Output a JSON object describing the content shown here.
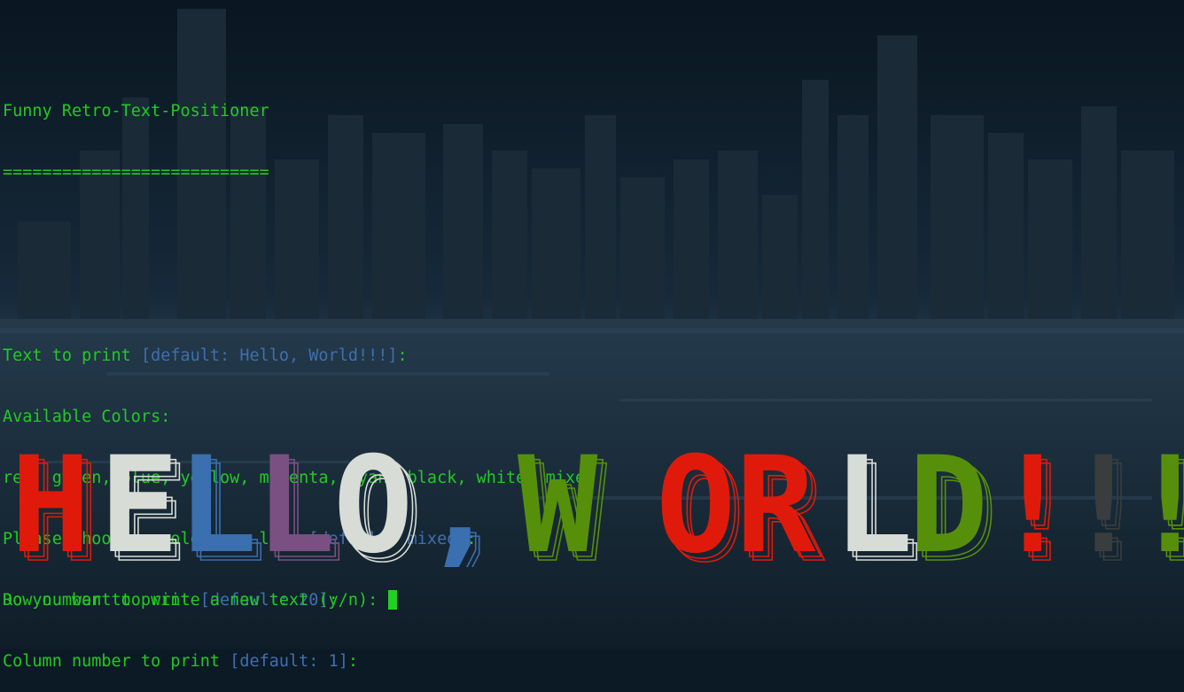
{
  "terminal": {
    "title": "Funny Retro-Text-Positioner",
    "underline": "===========================",
    "lines": [
      {
        "label": "Text to print ",
        "hint": "[default: Hello, World!!!]",
        "end": ":"
      },
      {
        "label": "Available Colors:",
        "hint": "",
        "end": ""
      },
      {
        "label": "red, green, blue, yellow, magenta, cyan, black, white, mixed",
        "hint": "",
        "end": ""
      },
      {
        "label": "Please choose a color you like ",
        "hint": "[default: mixed]",
        "end": ":"
      },
      {
        "label": "Row number to print ",
        "hint": "[default: 20]",
        "end": ":"
      },
      {
        "label": "Column number to print ",
        "hint": "[default: 1]",
        "end": ":"
      }
    ],
    "banner_text": "HELLO, WORLD!!!",
    "banner_colors": [
      "#e01a0a",
      "#d8dcd6",
      "#3a6fb0",
      "#7a5082",
      "#d8dcd6",
      "#3a6fb0",
      "#e01a0a",
      "#56900a",
      "#e01a0a",
      "#e01a0a",
      "#d8dcd6",
      "#56900a",
      "#e01a0a",
      "#3a3d3d",
      "#56900a"
    ],
    "question": "Do you want to write a new text (y/n): "
  }
}
